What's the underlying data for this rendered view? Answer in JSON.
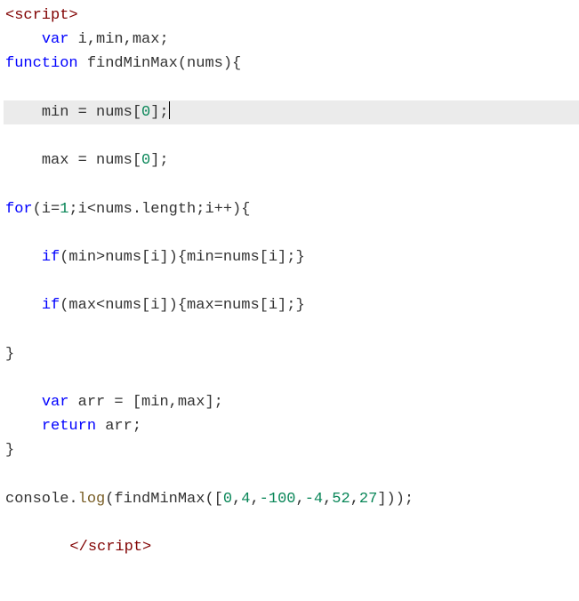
{
  "code": {
    "lines": [
      {
        "segments": [
          {
            "t": "<",
            "c": "tag"
          },
          {
            "t": "script",
            "c": "tag"
          },
          {
            "t": ">",
            "c": "tag"
          }
        ],
        "indent": 0,
        "hl": false
      },
      {
        "segments": [
          {
            "t": "var",
            "c": "kw"
          },
          {
            "t": " i,min,max;",
            "c": "txt"
          }
        ],
        "indent": 1,
        "hl": false
      },
      {
        "segments": [
          {
            "t": "function",
            "c": "kw"
          },
          {
            "t": " findMinMax(nums){",
            "c": "txt"
          }
        ],
        "indent": 0,
        "hl": false
      },
      {
        "segments": [],
        "indent": 0,
        "hl": false
      },
      {
        "segments": [
          {
            "t": "min = nums[",
            "c": "txt"
          },
          {
            "t": "0",
            "c": "num"
          },
          {
            "t": "];",
            "c": "txt"
          }
        ],
        "indent": 1,
        "hl": true,
        "cursor": true
      },
      {
        "segments": [],
        "indent": 0,
        "hl": false
      },
      {
        "segments": [
          {
            "t": "max = nums[",
            "c": "txt"
          },
          {
            "t": "0",
            "c": "num"
          },
          {
            "t": "];",
            "c": "txt"
          }
        ],
        "indent": 1,
        "hl": false
      },
      {
        "segments": [],
        "indent": 0,
        "hl": false
      },
      {
        "segments": [
          {
            "t": "for",
            "c": "kw"
          },
          {
            "t": "(i=",
            "c": "txt"
          },
          {
            "t": "1",
            "c": "num"
          },
          {
            "t": ";i<nums.length;i++){",
            "c": "txt"
          }
        ],
        "indent": 0,
        "hl": false
      },
      {
        "segments": [],
        "indent": 0,
        "hl": false
      },
      {
        "segments": [
          {
            "t": "if",
            "c": "kw"
          },
          {
            "t": "(min>nums[i]){min=nums[i];}",
            "c": "txt"
          }
        ],
        "indent": 1,
        "hl": false
      },
      {
        "segments": [],
        "indent": 0,
        "hl": false
      },
      {
        "segments": [
          {
            "t": "if",
            "c": "kw"
          },
          {
            "t": "(max<nums[i]){max=nums[i];}",
            "c": "txt"
          }
        ],
        "indent": 1,
        "hl": false
      },
      {
        "segments": [],
        "indent": 0,
        "hl": false
      },
      {
        "segments": [
          {
            "t": "}",
            "c": "txt"
          }
        ],
        "indent": 0,
        "hl": false
      },
      {
        "segments": [],
        "indent": 0,
        "hl": false
      },
      {
        "segments": [
          {
            "t": "var",
            "c": "kw"
          },
          {
            "t": " arr = [min,max];",
            "c": "txt"
          }
        ],
        "indent": 1,
        "hl": false
      },
      {
        "segments": [
          {
            "t": "return",
            "c": "kw"
          },
          {
            "t": " arr;",
            "c": "txt"
          }
        ],
        "indent": 1,
        "hl": false
      },
      {
        "segments": [
          {
            "t": "}",
            "c": "txt"
          }
        ],
        "indent": 0,
        "hl": false
      },
      {
        "segments": [],
        "indent": 0,
        "hl": false
      },
      {
        "segments": [
          {
            "t": "console.",
            "c": "txt"
          },
          {
            "t": "log",
            "c": "fn"
          },
          {
            "t": "(findMinMax([",
            "c": "txt"
          },
          {
            "t": "0",
            "c": "num"
          },
          {
            "t": ",",
            "c": "txt"
          },
          {
            "t": "4",
            "c": "num"
          },
          {
            "t": ",",
            "c": "txt"
          },
          {
            "t": "-100",
            "c": "num"
          },
          {
            "t": ",",
            "c": "txt"
          },
          {
            "t": "-4",
            "c": "num"
          },
          {
            "t": ",",
            "c": "txt"
          },
          {
            "t": "52",
            "c": "num"
          },
          {
            "t": ",",
            "c": "txt"
          },
          {
            "t": "27",
            "c": "num"
          },
          {
            "t": "]));",
            "c": "txt"
          }
        ],
        "indent": 0,
        "hl": false
      },
      {
        "segments": [],
        "indent": 0,
        "hl": false
      },
      {
        "segments": [
          {
            "t": "</",
            "c": "tag"
          },
          {
            "t": "script",
            "c": "tag"
          },
          {
            "t": ">",
            "c": "tag"
          }
        ],
        "indent": 2,
        "hl": false,
        "guide": true
      }
    ]
  }
}
